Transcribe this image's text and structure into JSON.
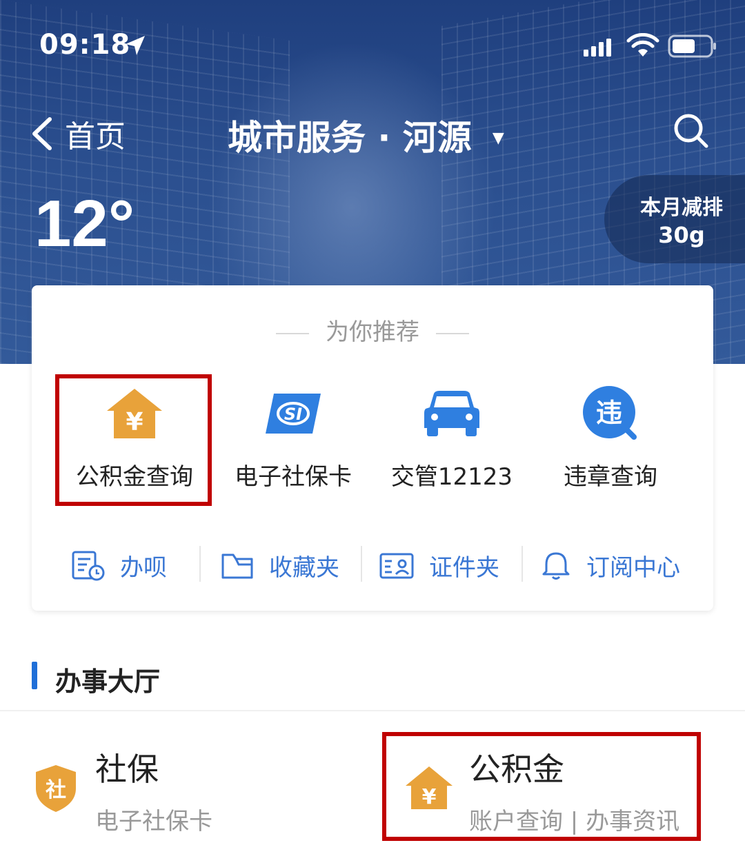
{
  "status": {
    "time": "09:18"
  },
  "nav": {
    "back_label": "首页",
    "title": "城市服务 · 河源",
    "caret": "▼"
  },
  "weather": {
    "temperature": "12°"
  },
  "emission": {
    "label": "本月减排",
    "value": "30g"
  },
  "recommend": {
    "title": "为你推荐",
    "items": [
      {
        "label": "公积金查询",
        "icon": "housing-fund-icon"
      },
      {
        "label": "电子社保卡",
        "icon": "social-security-card-icon"
      },
      {
        "label": "交管12123",
        "icon": "car-icon"
      },
      {
        "label": "违章查询",
        "icon": "violation-search-icon"
      }
    ]
  },
  "quick_links": [
    {
      "label": "办呗",
      "icon": "task-icon"
    },
    {
      "label": "收藏夹",
      "icon": "folder-icon"
    },
    {
      "label": "证件夹",
      "icon": "id-card-icon"
    },
    {
      "label": "订阅中心",
      "icon": "bell-icon"
    }
  ],
  "hall": {
    "title": "办事大厅",
    "items": [
      {
        "title": "社保",
        "badge": "社",
        "subtitle": "电子社保卡",
        "icon": "shield-icon"
      },
      {
        "title": "公积金",
        "badge": "¥",
        "subtitle": "账户查询 | 办事资讯",
        "icon": "housing-fund-icon"
      }
    ]
  },
  "colors": {
    "accent_blue": "#3a77d4",
    "highlight_red": "#c00000",
    "fund_orange": "#e8a23a",
    "banner_blue": "#2b4f8f"
  }
}
